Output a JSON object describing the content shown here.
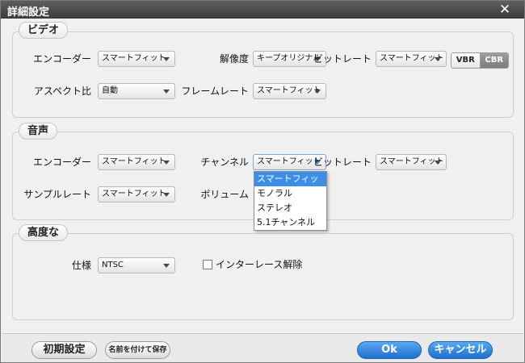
{
  "window": {
    "title": "詳細設定",
    "close_glyph": "✕"
  },
  "video": {
    "legend": "ビデオ",
    "encoder": {
      "label": "エンコーダー",
      "value": "スマートフィット"
    },
    "resolution": {
      "label": "解像度",
      "value": "キープオリジナル"
    },
    "bitrate": {
      "label": "ビットレート",
      "value": "スマートフィット"
    },
    "mode_toggle": {
      "options": [
        "VBR",
        "CBR"
      ],
      "selected": "CBR"
    },
    "aspect": {
      "label": "アスペクト比",
      "value": "自動"
    },
    "framerate": {
      "label": "フレームレート",
      "value": "スマートフィット"
    }
  },
  "audio": {
    "legend": "音声",
    "encoder": {
      "label": "エンコーダー",
      "value": "スマートフィット"
    },
    "channel": {
      "label": "チャンネル",
      "value": "スマートフィット"
    },
    "bitrate": {
      "label": "ビットレート",
      "value": "スマートフィット"
    },
    "samplerate": {
      "label": "サンプルレート",
      "value": "スマートフィット"
    },
    "volume": {
      "label": "ボリューム"
    },
    "channel_options": [
      "スマートフィッ",
      "モノラル",
      "ステレオ",
      "5.1チャンネル"
    ],
    "channel_options_highlighted": 0
  },
  "advanced": {
    "legend": "高度な",
    "spec": {
      "label": "仕様",
      "value": "NTSC"
    },
    "deinterlace": {
      "label": "インターレース解除",
      "checked": false
    }
  },
  "footer": {
    "defaults_label": "初期設定",
    "save_as_label": "名前を付けて保存",
    "ok_label": "Ok",
    "cancel_label": "キャンセル"
  },
  "colors": {
    "accent": "#3d8ee8",
    "titlebar": "#4a4a4a",
    "ok_button": "#2a7fd8"
  }
}
